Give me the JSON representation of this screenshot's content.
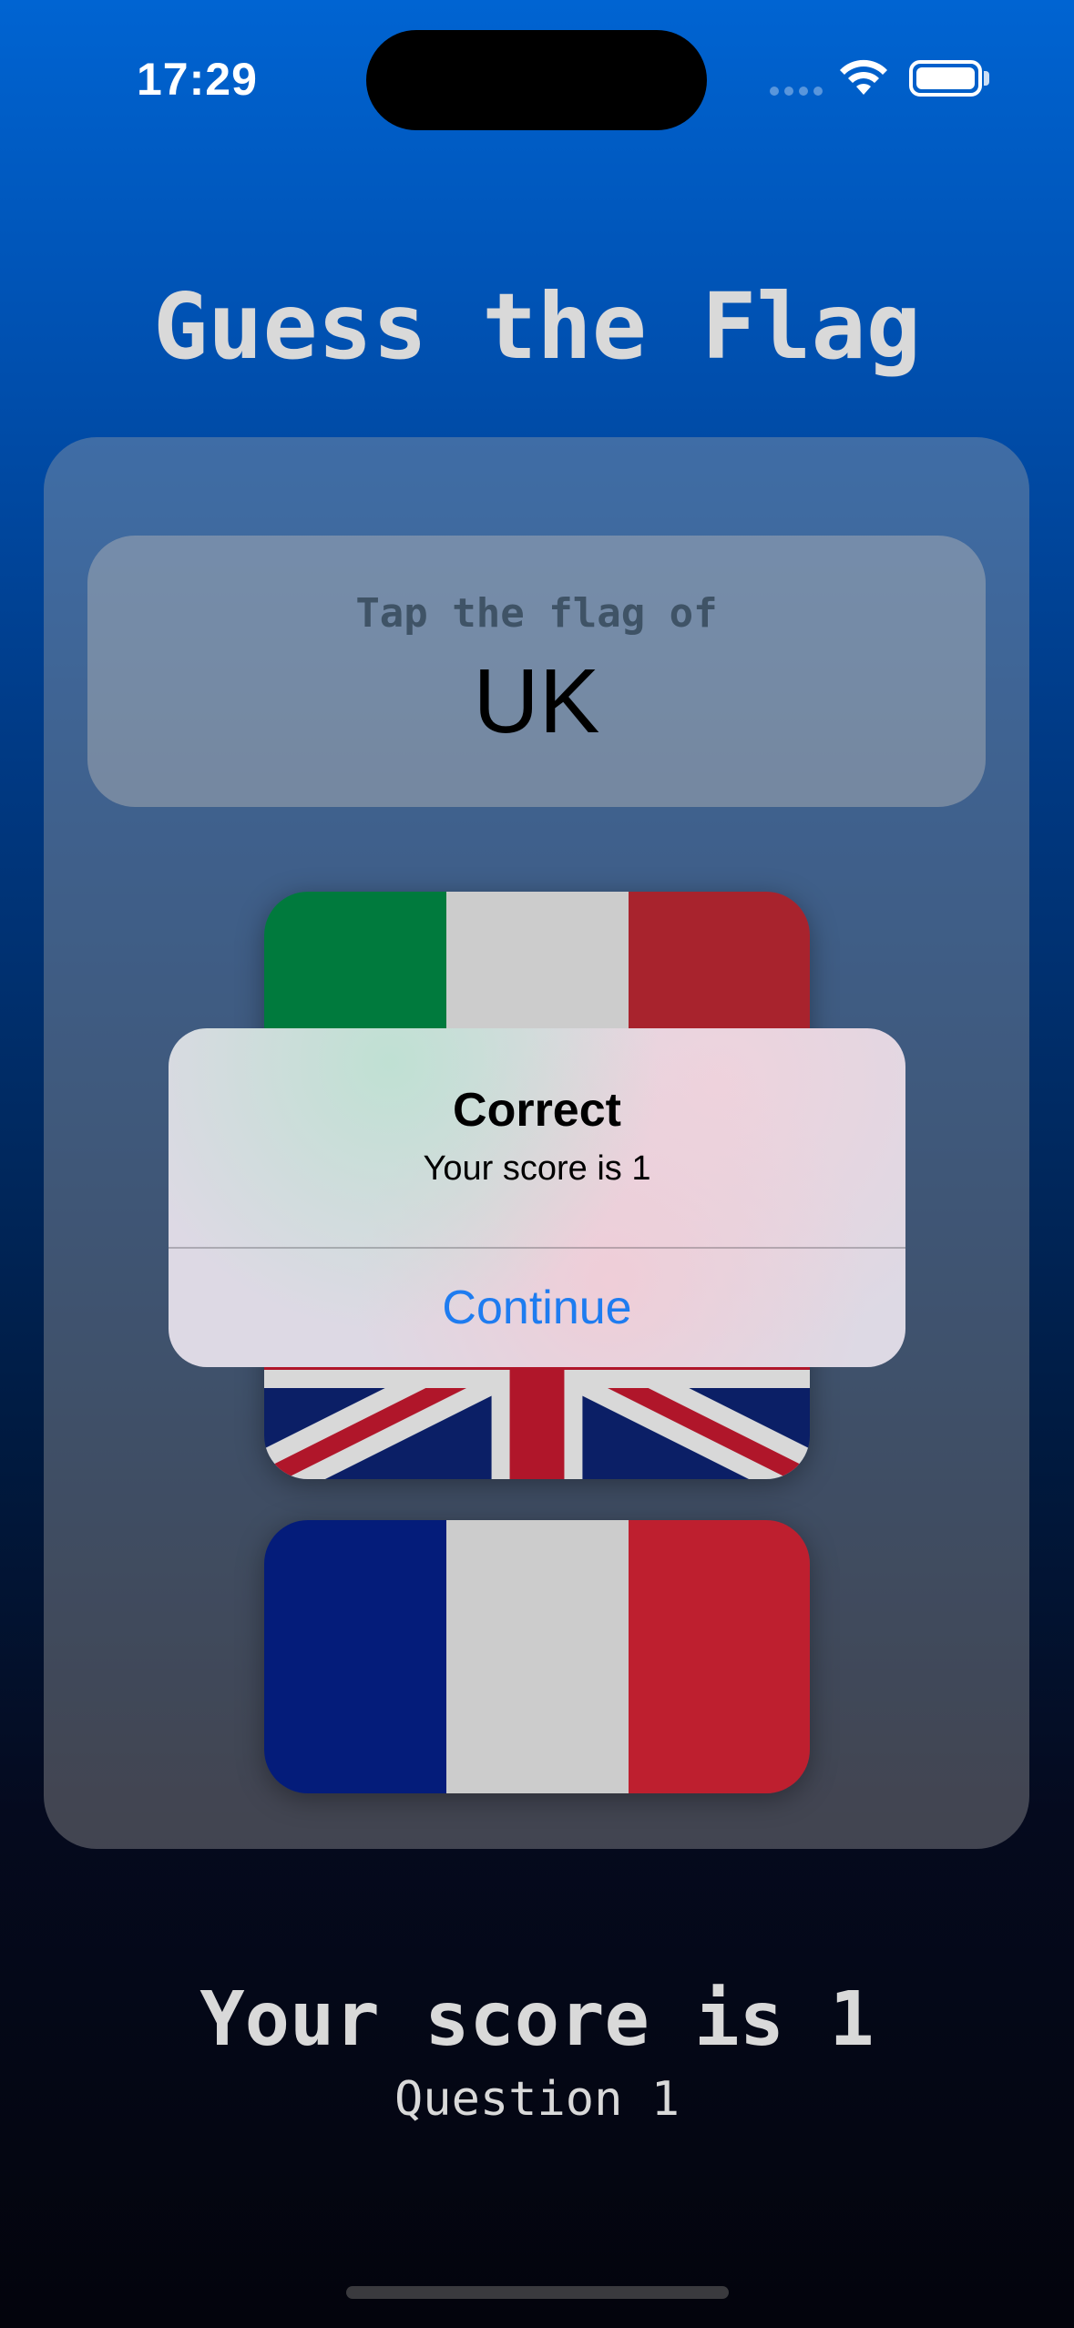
{
  "status_bar": {
    "time": "17:29",
    "icons": [
      "cellular-dots-icon",
      "wifi-icon",
      "battery-icon"
    ]
  },
  "title": "Guess the Flag",
  "prompt": {
    "label": "Tap the flag of",
    "country": "UK"
  },
  "flags": [
    {
      "name": "Italy",
      "colors": [
        "#007a3d",
        "#cccccc",
        "#a8232d"
      ]
    },
    {
      "name": "UK",
      "colors": {
        "blue": "#0b1f66",
        "red": "#b0162a",
        "white": "#d8d8d8"
      }
    },
    {
      "name": "France",
      "colors": [
        "#041c7a",
        "#cccccc",
        "#be1f2f"
      ]
    }
  ],
  "alert": {
    "title": "Correct",
    "message": "Your score is 1",
    "button": "Continue"
  },
  "footer": {
    "score": "Your score is 1",
    "question": "Question 1"
  },
  "colors": {
    "accent": "#1e7cf0",
    "title_text": "#d9d9d9"
  }
}
